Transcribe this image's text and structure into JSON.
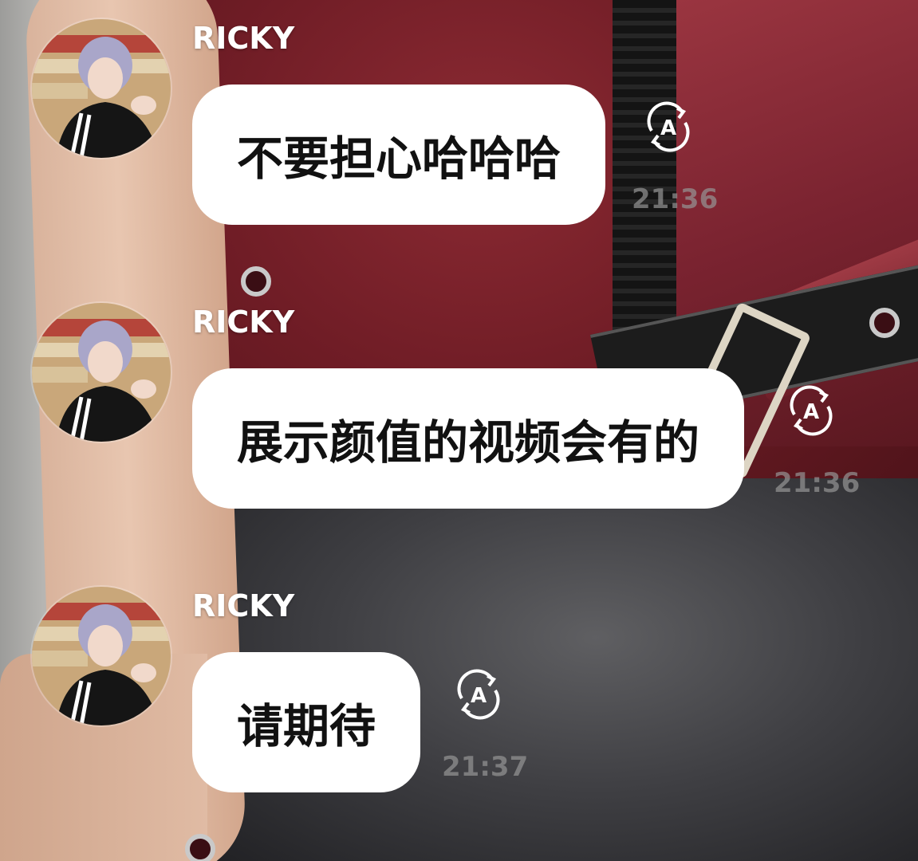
{
  "messages": [
    {
      "sender": "RICKY",
      "text": "不要担心哈哈哈",
      "time": "21:36"
    },
    {
      "sender": "RICKY",
      "text": "展示颜值的视频会有的",
      "time": "21:36"
    },
    {
      "sender": "RICKY",
      "text": "请期待",
      "time": "21:37"
    }
  ],
  "icons": {
    "translate": "translate-icon",
    "avatar": "avatar"
  },
  "colors": {
    "bubble": "#ffffff",
    "bubble_text": "#111111",
    "name": "#ffffff",
    "time": "#969696"
  }
}
